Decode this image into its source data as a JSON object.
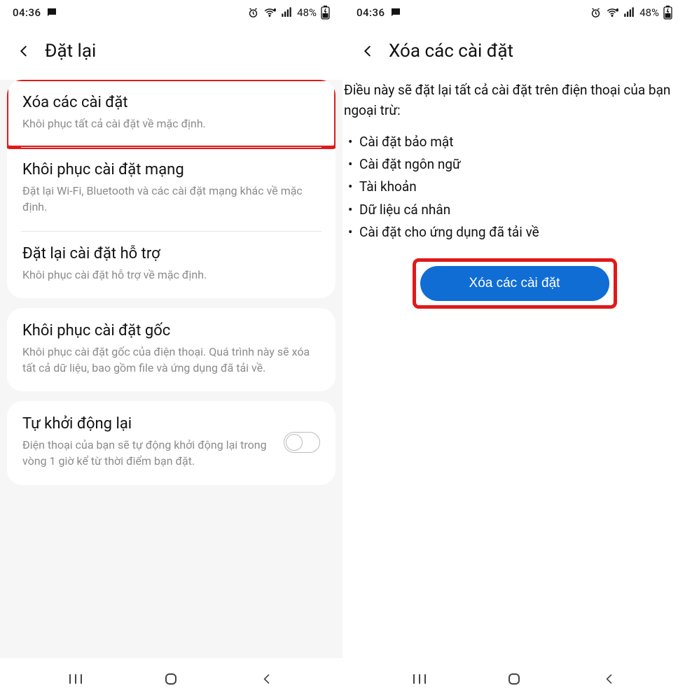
{
  "status": {
    "time": "04:36",
    "battery_pct": "48%"
  },
  "left": {
    "header_title": "Đặt lại",
    "group1": [
      {
        "title": "Xóa các cài đặt",
        "desc": "Khôi phục tất cả cài đặt về mặc định."
      },
      {
        "title": "Khôi phục cài đặt mạng",
        "desc": "Đặt lại Wi-Fi, Bluetooth và các cài đặt mạng khác về mặc định."
      },
      {
        "title": "Đặt lại cài đặt hỗ trợ",
        "desc": "Khôi phục cài đặt hỗ trợ về mặc định."
      }
    ],
    "group2": {
      "title": "Khôi phục cài đặt gốc",
      "desc": "Khôi phục cài đặt gốc của điện thoại. Quá trình này sẽ xóa tất cả dữ liệu, bao gồm file và ứng dụng đã tải về."
    },
    "group3": {
      "title": "Tự khởi động lại",
      "desc": "Điện thoại của bạn sẽ tự động khởi động lại trong vòng 1 giờ kể từ thời điểm bạn đặt."
    }
  },
  "right": {
    "header_title": "Xóa các cài đặt",
    "intro": "Điều này sẽ đặt lại tất cả cài đặt trên điện thoại của bạn ngoại trừ:",
    "bullets": [
      "Cài đặt bảo mật",
      "Cài đặt ngôn ngữ",
      "Tài khoản",
      "Dữ liệu cá nhân",
      "Cài đặt cho ứng dụng đã tải về"
    ],
    "button_label": "Xóa các cài đặt"
  }
}
